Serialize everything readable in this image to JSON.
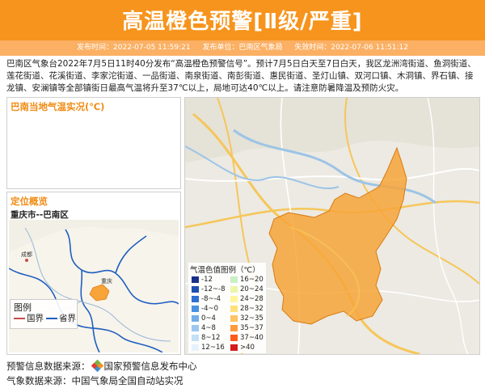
{
  "header": {
    "title": "高温橙色预警[Ⅱ级/严重]",
    "publish_time": "发布时间：2022-07-05 11:59:21",
    "publisher": "发布单位：巴南区气象局",
    "expire_time": "失效时间：2022-07-06 11:51:12"
  },
  "body_text": "巴南区气象台2022年7月5日11时40分发布“高温橙色预警信号”。预计7月5日白天至7日白天，我区龙洲湾街道、鱼洞街道、莲花街道、花溪街道、李家沱街道、一品街道、南泉街道、南彭街道、惠民街道、圣灯山镇、双河口镇、木洞镇、界石镇、接龙镇、安澜镇等全部镇街日最高气温将升至37℃以上，局地可达40℃以上。请注意防暑降温及预防火灾。",
  "temp_panel": {
    "title": "巴南当地气温实况(℃)"
  },
  "location_panel": {
    "title": "定位概览",
    "subtitle": "重庆市--巴南区",
    "map_labels": {
      "chengdu": "成都",
      "chongqing": "重庆"
    },
    "legend_title": "图例",
    "legend_items": [
      {
        "label": "国界",
        "color": "#c94c4c"
      },
      {
        "label": "省界",
        "color": "#1f5fbf"
      }
    ]
  },
  "temp_legend": {
    "title": "气温色值图例（℃）",
    "left": [
      {
        "label": "-12",
        "color": "#1a2f8a"
      },
      {
        "label": "-12~-8",
        "color": "#1e4fb0"
      },
      {
        "label": "-8~-4",
        "color": "#2f6fd0"
      },
      {
        "label": "-4~0",
        "color": "#4a90e2"
      },
      {
        "label": "0~4",
        "color": "#74aee9"
      },
      {
        "label": "4~8",
        "color": "#9cc8f0"
      },
      {
        "label": "8~12",
        "color": "#c4e0f6"
      },
      {
        "label": "12~16",
        "color": "#e6f2fb"
      }
    ],
    "right": [
      {
        "label": "16~20",
        "color": "#c9f0c4"
      },
      {
        "label": "20~24",
        "color": "#ecf7a6"
      },
      {
        "label": "24~28",
        "color": "#fff59c"
      },
      {
        "label": "28~32",
        "color": "#ffe07a"
      },
      {
        "label": "32~35",
        "color": "#ffc264"
      },
      {
        "label": "35~37",
        "color": "#ff9a3c"
      },
      {
        "label": "37~40",
        "color": "#ff5a1a"
      },
      {
        "label": ">40",
        "color": "#d41a1a"
      }
    ]
  },
  "footer": {
    "source_label": "预警信息数据来源：",
    "source_name": "国家预警信息发布中心",
    "weather_source": "气象数据来源：中国气象局全国自动站实况"
  },
  "colors": {
    "accent": "#f7941d",
    "warning_area": "#f7a43a"
  }
}
